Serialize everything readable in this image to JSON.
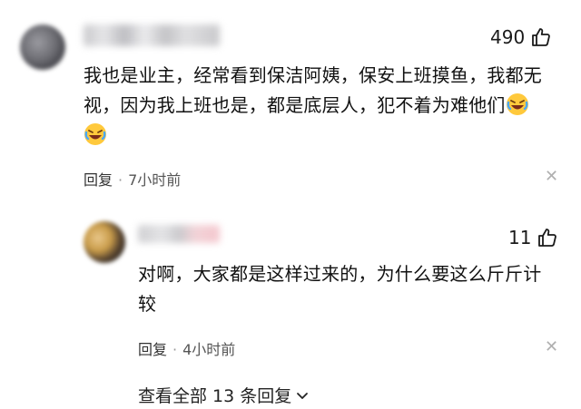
{
  "comment": {
    "likes": "490",
    "text_line1": "我也是业主，经常看到保洁阿姨，保安上班摸鱼，我都无",
    "text_line2": "视，因为我上班也是，都是底层人，犯不着为难他们",
    "emoji": "laughing-crying-emoji",
    "reply_label": "回复",
    "time": "7小时前"
  },
  "reply": {
    "likes": "11",
    "text_line1": "对啊，大家都是这样过来的，为什么要这么斤斤计",
    "text_line2": "较",
    "reply_label": "回复",
    "time": "4小时前"
  },
  "view_more": "查看全部 13 条回复"
}
